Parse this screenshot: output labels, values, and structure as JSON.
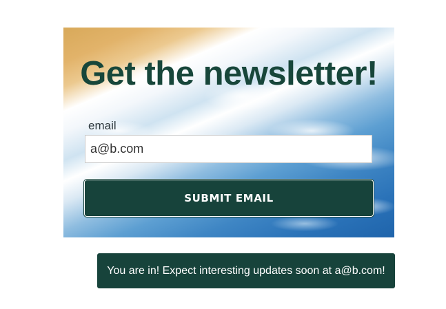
{
  "newsletter": {
    "title": "Get the newsletter!",
    "email_label": "email",
    "email_value": "a@b.com",
    "email_placeholder": "a@b.com",
    "submit_label": "SUBMIT EMAIL"
  },
  "toast": {
    "message": "You are in! Expect interesting updates soon at a@b.com!"
  },
  "colors": {
    "primary": "#17433b",
    "title": "#17463a",
    "toast_text": "#ffffff"
  }
}
